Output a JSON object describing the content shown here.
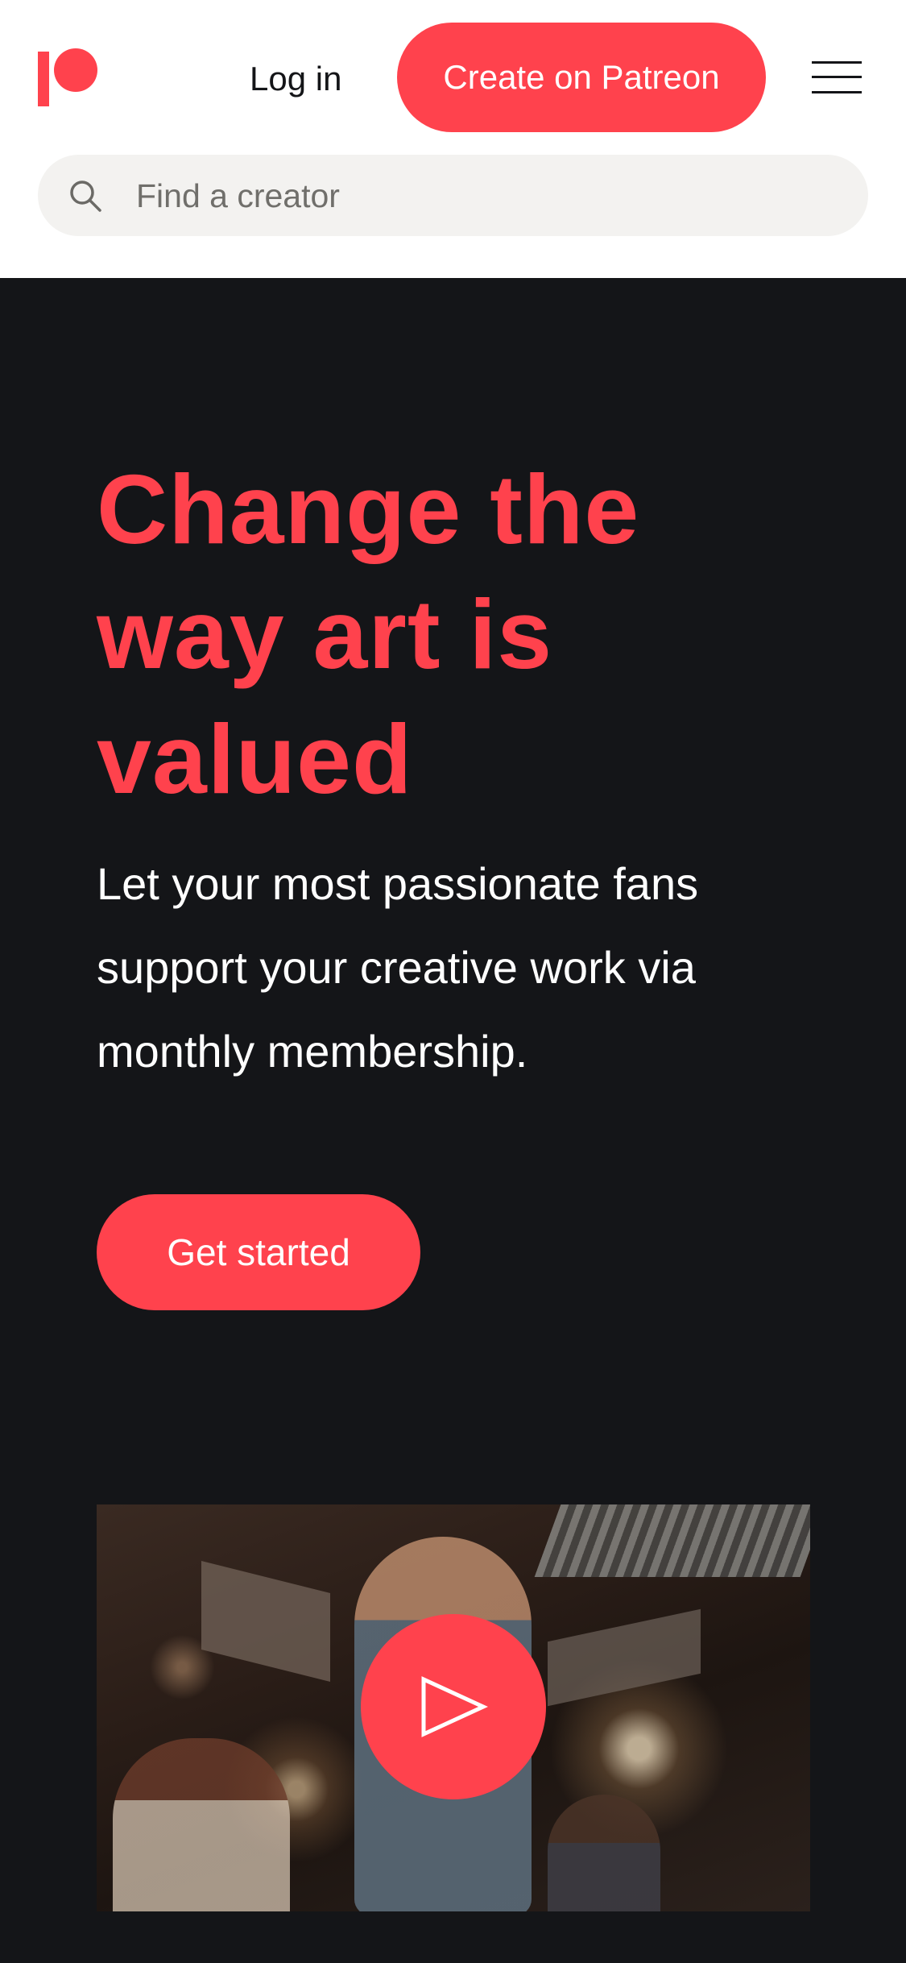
{
  "header": {
    "login_label": "Log in",
    "create_label": "Create on Patreon",
    "search_placeholder": "Find a creator",
    "icons": [
      "patreon-logo",
      "menu-icon",
      "search-icon"
    ]
  },
  "hero": {
    "headline": "Change the way art is valued",
    "subhead": "Let your most passionate fans support your creative work via monthly membership.",
    "cta_label": "Get started",
    "video": {
      "play_icon": "play-icon"
    }
  },
  "colors": {
    "brand": "#ff424d",
    "dark_bg": "#141518",
    "header_bg": "#ffffff",
    "search_bg": "#f3f2f0"
  }
}
